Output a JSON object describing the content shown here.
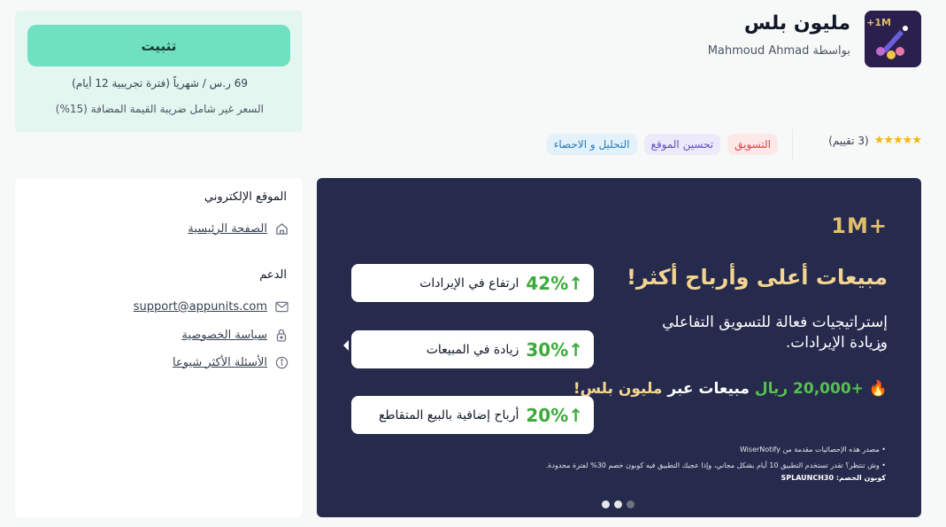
{
  "app": {
    "name": "مليون بلس",
    "author": "بواسطة Mahmoud Ahmad",
    "icon_text": "1M+"
  },
  "install": {
    "button_label": "تثبيت",
    "price": "69 ر.س / شهرياً (فترة تجريبية 12 أيام)",
    "vat_note": "السعر غير شامل ضريبة القيمة المضافة (15%)"
  },
  "rating": {
    "stars": "★★★★★",
    "count_text": "(3 تقييم)"
  },
  "tags": [
    "التسويق",
    "تحسين الموقع",
    "التحليل و الاحصاء"
  ],
  "sidebar": {
    "website_title": "الموقع الإلكتروني",
    "home_link": "الصفحة الرئيسية",
    "support_title": "الدعم",
    "support_email": "support@appunits.com",
    "privacy_link": "سياسة الخصوصية",
    "faq_link": "الأسئلة الأكثر شيوعا"
  },
  "banner": {
    "logo": "1M+",
    "headline": "مبيعات أعلى وأرباح أكثر!",
    "paragraph": "إستراتيجيات فعالة للتسويق التفاعلي وزيادة الإيرادات.",
    "sales_emoji": "🔥",
    "sales_number": "+20,000 ريال",
    "sales_text": "مبيعات عبر",
    "sales_brand": "مليون بلس!",
    "note1": "• مصدر هذه الإحصائيات مقدمة من WiserNotify",
    "note2": "• وش تنتظر؟ تقدر تستخدم التطبيق 10 أيام بشكل مجاني، وإذا عجبك التطبيق فيه كوبون خصم 30% لفترة محدودة.",
    "note3": "كوبون الخصم: SPLAUNCH30",
    "stats": [
      {
        "value": "42%",
        "label": "ارتفاع في الإيرادات"
      },
      {
        "value": "30%",
        "label": "زيادة في المبيعات"
      },
      {
        "value": "20%",
        "label": "أرباح إضافية بالبيع المتقاطع"
      }
    ]
  },
  "colors": {
    "accent": "#6fe0c0",
    "banner_bg": "#262a4d",
    "gold": "#f4d590",
    "green": "#3caa3a"
  }
}
